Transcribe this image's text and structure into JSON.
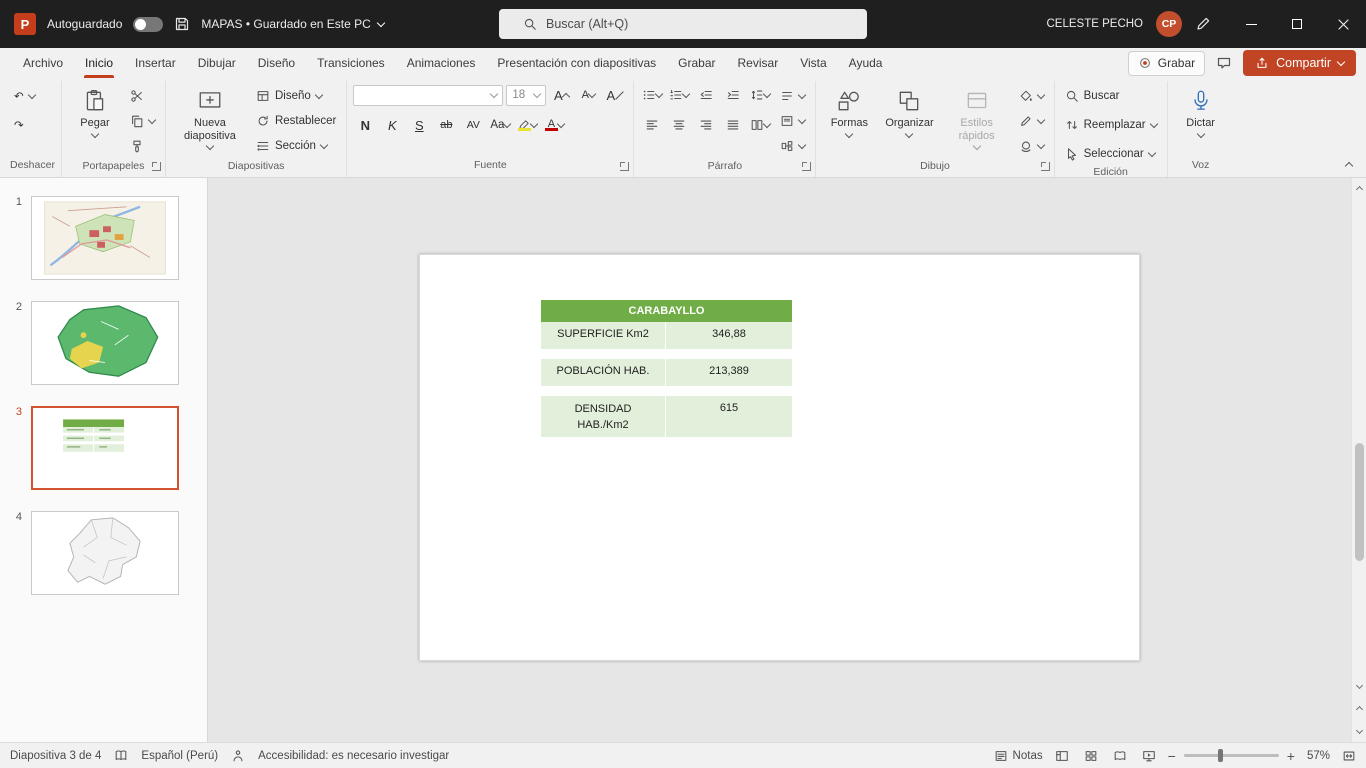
{
  "colors": {
    "accent_red": "#C43E1C",
    "share_button": "#C14524",
    "table_header_green": "#70AD47",
    "table_row_green": "#E2EFDA",
    "selected_slide_border": "#D35230"
  },
  "titlebar": {
    "logo_letter": "P",
    "autosave": "Autoguardado",
    "title": "MAPAS • Guardado en Este PC",
    "search": "Buscar (Alt+Q)",
    "user": "CELESTE PECHO",
    "initials": "CP"
  },
  "tabs": {
    "items": [
      "Archivo",
      "Inicio",
      "Insertar",
      "Dibujar",
      "Diseño",
      "Transiciones",
      "Animaciones",
      "Presentación con diapositivas",
      "Grabar",
      "Revisar",
      "Vista",
      "Ayuda"
    ],
    "grabar": "Grabar",
    "compartir": "Compartir"
  },
  "ribbon": {
    "groups": {
      "deshacer": "Deshacer",
      "portapapeles": "Portapapeles",
      "diapositivas": "Diapositivas",
      "fuente": "Fuente",
      "parrafo": "Párrafo",
      "dibujo": "Dibujo",
      "edicion": "Edición",
      "voz": "Voz"
    },
    "portapapeles": {
      "pegar": "Pegar"
    },
    "diapositivas": {
      "nueva": "Nueva diapositiva",
      "diseno": "Diseño",
      "restablecer": "Restablecer",
      "seccion": "Sección"
    },
    "fuente": {
      "name": "",
      "size": "18",
      "grow": "A",
      "shrink": "A",
      "clear": "A",
      "bold": "N",
      "italic": "K",
      "underline": "S",
      "strike": "ab",
      "spacing": "AV",
      "case": "Aa",
      "color": "A"
    },
    "dibujo": {
      "formas": "Formas",
      "organizar": "Organizar",
      "estilos": "Estilos rápidos"
    },
    "edicion": {
      "buscar": "Buscar",
      "reemplazar": "Reemplazar",
      "seleccionar": "Seleccionar"
    },
    "voz": {
      "dictar": "Dictar"
    }
  },
  "icons": {
    "undo": "↶",
    "redo": "↷",
    "zoom_out": "−",
    "zoom_in": "+"
  },
  "slides": {
    "numbers": [
      "1",
      "2",
      "3",
      "4"
    ]
  },
  "slide": {
    "table": {
      "title": "CARABAYLLO",
      "rows": [
        {
          "label": "SUPERFICIE Km2",
          "value": "346,88"
        },
        {
          "label": "POBLACIÓN HAB.",
          "value": "213,389"
        },
        {
          "label": "DENSIDAD HAB./Km2",
          "value": "615"
        }
      ]
    }
  },
  "status": {
    "counter": "Diapositiva 3 de 4",
    "language": "Español (Perú)",
    "accessibility": "Accesibilidad: es necesario investigar",
    "notes": "Notas",
    "zoom": "57%"
  }
}
